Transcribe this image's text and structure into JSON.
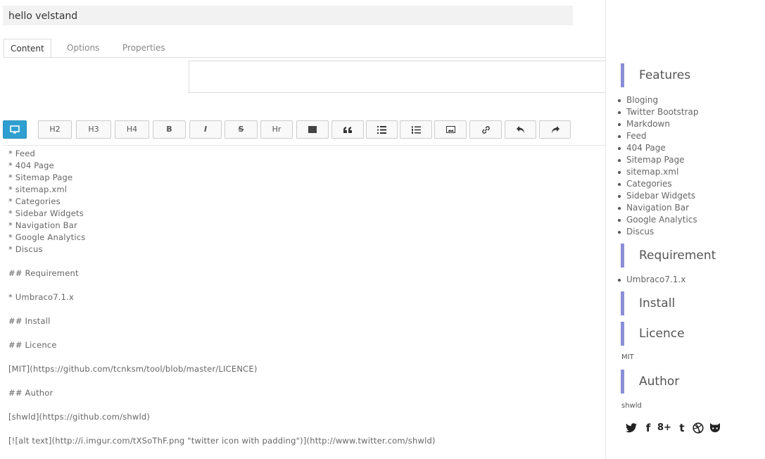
{
  "editor": {
    "title_value": "hello velstand",
    "tabs": [
      "Content",
      "Options",
      "Properties"
    ],
    "toolbar": [
      "H2",
      "H3",
      "H4",
      "B",
      "I",
      "S",
      "Hr"
    ],
    "markdown_lines": [
      "* Feed",
      "* 404 Page",
      "* Sitemap Page",
      "* sitemap.xml",
      "* Categories",
      "* Sidebar Widgets",
      "* Navigation Bar",
      "* Google Analytics",
      "* Discus",
      "## Requirement",
      "* Umbraco7.1.x",
      "## Install",
      "## Licence",
      "[MIT](https://github.com/tcnksm/tool/blob/master/LICENCE)",
      "## Author",
      "[shwld](https://github.com/shwld)",
      "[![alt text](http://i.imgur.com/tXSoThF.png \"twitter icon with padding\")](http://www.twitter.com/shwld)"
    ]
  },
  "preview": {
    "features_title": "Features",
    "features": [
      "Bloging",
      "Twitter Bootstrap",
      "Markdown",
      "Feed",
      "404 Page",
      "Sitemap Page",
      "sitemap.xml",
      "Categories",
      "Sidebar Widgets",
      "Navigation Bar",
      "Google Analytics",
      "Discus"
    ],
    "requirement_title": "Requirement",
    "requirements": [
      "Umbraco7.1.x"
    ],
    "install_title": "Install",
    "licence_title": "Licence",
    "licence_text": "MIT",
    "author_title": "Author",
    "author_text": "shwld",
    "social_icons": [
      "twitter-icon",
      "facebook-icon",
      "google-plus-icon",
      "tumblr-icon",
      "dribbble-icon",
      "github-icon"
    ],
    "social_labels": [
      "f",
      "8+",
      "t"
    ]
  },
  "colors": {
    "primary_button": "#2e9fd0",
    "section_accent": "#8a8fd6"
  }
}
